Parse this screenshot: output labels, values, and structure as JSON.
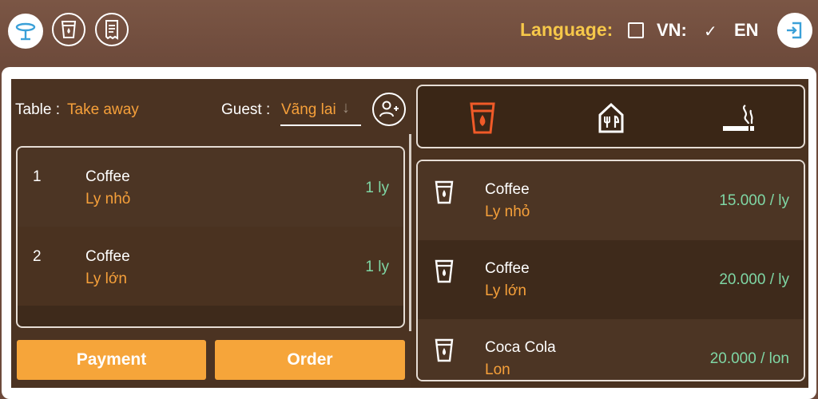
{
  "header": {
    "language_label": "Language:",
    "lang_vn": "VN:",
    "lang_en": "EN",
    "check_mark": "✓"
  },
  "order_info": {
    "table_label": "Table :",
    "table_value": "Take away",
    "guest_label": "Guest :",
    "guest_value": "Vãng lai",
    "guest_arrow": "↓"
  },
  "order_items": [
    {
      "num": "1",
      "name": "Coffee",
      "size": "Ly nhỏ",
      "qty": "1 ly"
    },
    {
      "num": "2",
      "name": "Coffee",
      "size": "Ly lớn",
      "qty": "1 ly"
    }
  ],
  "buttons": {
    "payment": "Payment",
    "order": "Order"
  },
  "menu_items": [
    {
      "name": "Coffee",
      "size": "Ly nhỏ",
      "price": "15.000 / ly"
    },
    {
      "name": "Coffee",
      "size": "Ly lớn",
      "price": "20.000 / ly"
    },
    {
      "name": "Coca Cola",
      "size": "Lon",
      "price": "20.000 / lon"
    }
  ],
  "colors": {
    "accent_orange": "#f6a03a",
    "price_green": "#7fd7a5",
    "language_yellow": "#f6c84a",
    "active_category": "#f05a28"
  }
}
